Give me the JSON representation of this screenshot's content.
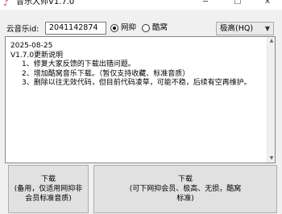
{
  "window": {
    "title": "音乐大师V1.7.0",
    "icon": "music-note-icon",
    "controls": {
      "minimize": "─",
      "maximize": "☐",
      "close": "✕"
    }
  },
  "form": {
    "id_label": "云音乐id:",
    "id_value": "2041142874",
    "sources": [
      {
        "label": "网抑",
        "selected": true
      },
      {
        "label": "酷窝",
        "selected": false
      }
    ],
    "quality_selected": "极高(HQ)"
  },
  "notes": {
    "date": "2025-08-25",
    "heading": "V1.7.0更新说明",
    "items": [
      "1、修复大家反馈的下载出错问题。",
      "2、增加酷窝音乐下载。（暂仅支持收藏、标准音质）",
      "3、删除以往无效代码，但目前代码凌草，可能不稳，后续有空再维护。"
    ]
  },
  "buttons": {
    "backup_line1": "下载",
    "backup_line2": "(备用，仅适用网抑非",
    "backup_line3": "会员标准音质)",
    "main_line1": "下载",
    "main_line2": "(可下网抑会员、极高、无损，酷窝",
    "main_line3": "标准)"
  },
  "colors": {
    "accent_icon": "#d8354b",
    "window_bg": "#f0f0f0"
  }
}
